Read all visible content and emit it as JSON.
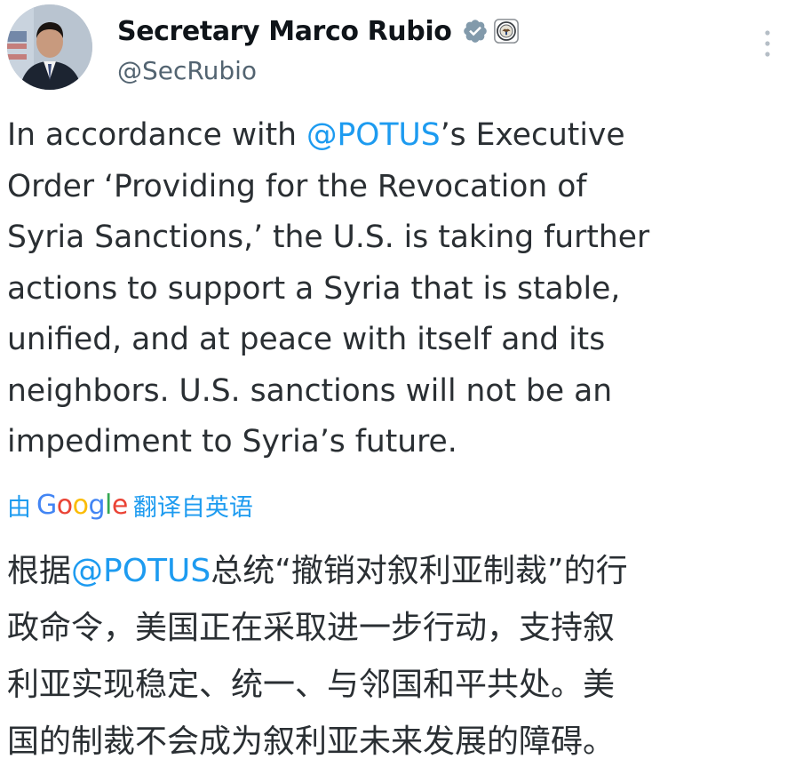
{
  "author": {
    "display_name": "Secretary Marco Rubio",
    "handle": "@SecRubio",
    "verified_badge": "verified-check-gray",
    "affiliation_badge": "department-of-state-seal"
  },
  "colors": {
    "link": "#1d9bf0",
    "text": "#0f1419",
    "secondary": "#536471",
    "verified_badge": "#829aab"
  },
  "post": {
    "mention": "@POTUS",
    "lines": [
      {
        "before": "In accordance with ",
        "mention": "@POTUS",
        "after": "’s Executive"
      },
      {
        "text": "Order ‘Providing for the Revocation of"
      },
      {
        "text": "Syria Sanctions,’ the U.S. is taking further"
      },
      {
        "text": "actions to support a Syria that is stable,"
      },
      {
        "text": "unified, and at peace with itself and its"
      },
      {
        "text": "neighbors. U.S. sanctions will not be an"
      },
      {
        "text": "impediment to Syria’s future."
      }
    ]
  },
  "translation": {
    "prefix": "由",
    "brand_letters": [
      "G",
      "o",
      "o",
      "g",
      "l",
      "e"
    ],
    "suffix": "翻译自英语"
  },
  "translated_post": {
    "lines": [
      {
        "before": "根据",
        "mention": "@POTUS",
        "after": "总统“撤销对叙利亚制裁”的行"
      },
      {
        "text": "政命令，美国正在采取进一步行动，支持叙"
      },
      {
        "text": "利亚实现稳定、统一、与邻国和平共处。美"
      },
      {
        "text": "国的制裁不会成为叙利亚未来发展的障碍。"
      }
    ]
  }
}
